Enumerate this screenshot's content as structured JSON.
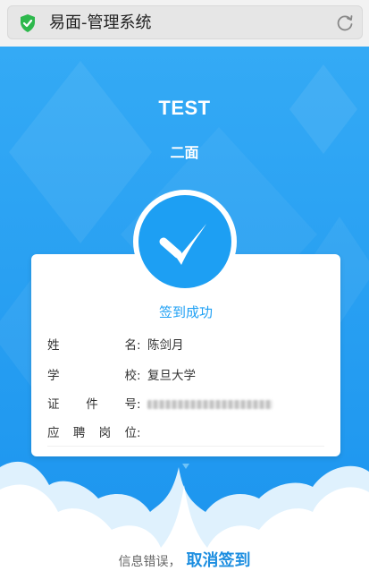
{
  "browser": {
    "url_title": "易面-管理系统",
    "shield_color": "#2db84c"
  },
  "header": {
    "title": "TEST",
    "subtitle": "二面"
  },
  "card": {
    "status": "签到成功",
    "fields": [
      {
        "label_chars": [
          "姓",
          "名"
        ],
        "value": "陈剑月"
      },
      {
        "label_chars": [
          "学",
          "校"
        ],
        "value": "复旦大学"
      },
      {
        "label_chars": [
          "证",
          "件",
          "号"
        ],
        "value": ""
      },
      {
        "label_chars": [
          "应",
          "聘",
          "岗",
          "位"
        ],
        "value": ""
      }
    ]
  },
  "footer": {
    "prompt": "信息错误，",
    "cancel_label": "取消签到"
  },
  "colors": {
    "primary": "#1fa0f4",
    "link": "#1d8ee0"
  }
}
